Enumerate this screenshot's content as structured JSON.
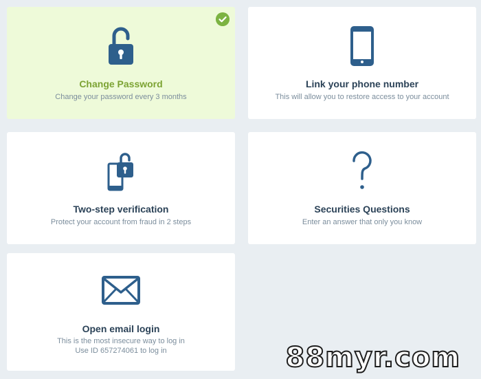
{
  "cards": [
    {
      "title": "Change Password",
      "subtitle": "Change your password every 3 months",
      "icon": "padlock-icon",
      "completed": true
    },
    {
      "title": "Link your phone number",
      "subtitle": "This will allow you to restore access to your account",
      "icon": "smartphone-icon"
    },
    {
      "title": "Two-step verification",
      "subtitle": "Protect your account from fraud in 2 steps",
      "icon": "phone-lock-icon"
    },
    {
      "title": "Securities Questions",
      "subtitle": "Enter an answer that only you know",
      "icon": "question-mark-icon"
    },
    {
      "title": "Open email login",
      "subtitle_lines": [
        "This is the most insecure way to log in",
        "Use ID 657274061 to log in"
      ],
      "icon": "envelope-icon"
    }
  ],
  "colors": {
    "icon": "#2e5f8c",
    "title": "#2b4257",
    "active_title": "#7ca333",
    "active_bg": "#eefad9",
    "subtitle": "#7b8d9c",
    "page_bg": "#e9eef2",
    "check": "#7cb342"
  },
  "watermark": "88myr.com"
}
